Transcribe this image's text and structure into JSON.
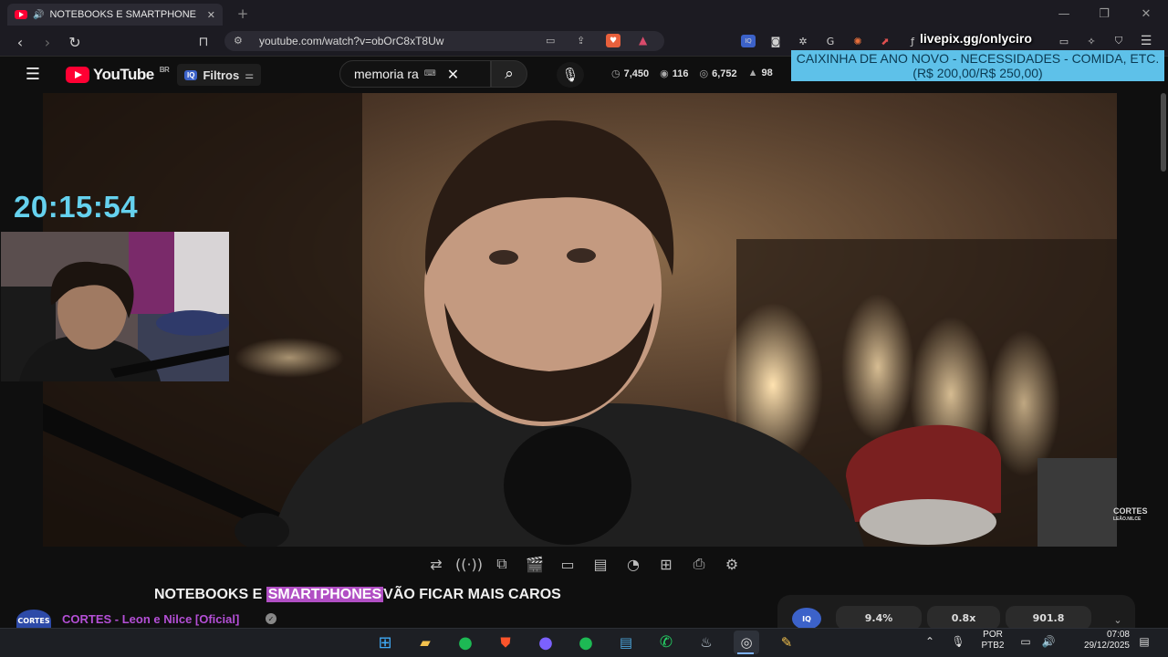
{
  "browser": {
    "tab_title": "NOTEBOOKS E SMARTPHONE",
    "tab_close": "✕",
    "new_tab": "+",
    "url": "youtube.com/watch?v=obOrC8xT8Uw",
    "window_controls": [
      "—",
      "❐",
      "✕"
    ]
  },
  "youtube": {
    "logo_text": "YouTube",
    "region": "BR",
    "filter_badge": "IQ",
    "filter_label": "Filtros",
    "search_value": "memoria ra",
    "stats": [
      {
        "icon": "clock-icon",
        "value": "7,450"
      },
      {
        "icon": "eye-icon",
        "value": "116"
      },
      {
        "icon": "play-count-icon",
        "value": "6,752"
      },
      {
        "icon": "thumbs-up-icon",
        "value": "98"
      }
    ]
  },
  "overlay": {
    "livepix": "livepix.gg/onlyciro",
    "donation_line1": "CAIXINHA DE ANO NOVO - NECESSIDADES - COMIDA, ETC.",
    "donation_line2": "(R$ 200,00/R$ 250,00)",
    "clock": "20:15:54",
    "watermark_line1": "CORTES",
    "watermark_line2": "LEÃO.NILCE"
  },
  "video": {
    "title_before": "NOTEBOOKS E",
    "title_highlight": "SMARTPHONES",
    "title_after": "VÃO FICAR MAIS CAROS",
    "channel_avatar": "CORTES",
    "channel_name": "CORTES - Leon e Nilce [Oficial]",
    "rating_badge": "IQ",
    "ratings": [
      "9.4%",
      "0.8x",
      "901.8"
    ]
  },
  "taskbar": {
    "lang_line1": "POR",
    "lang_line2": "PTB2",
    "time": "07:08",
    "date": "29/12/2025"
  },
  "colors": {
    "accent_red": "#ff0033",
    "donation_bg": "#5ec1e9",
    "clock": "#65d1ee",
    "highlight": "#b14fc4",
    "channel": "#b44fd6"
  }
}
